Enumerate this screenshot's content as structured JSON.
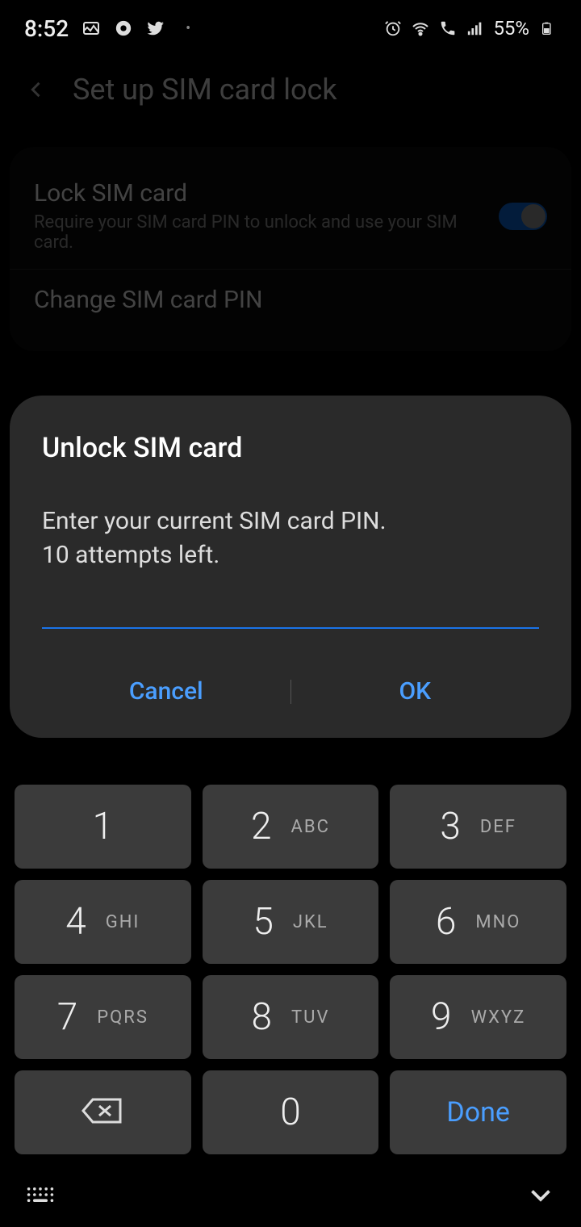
{
  "status": {
    "time": "8:52",
    "battery_percent": "55%"
  },
  "header": {
    "title": "Set up SIM card lock"
  },
  "settings": {
    "lock_sim": {
      "title": "Lock SIM card",
      "subtitle": "Require your SIM card PIN to unlock and use your SIM card.",
      "enabled": true
    },
    "change_pin": {
      "title": "Change SIM card PIN"
    }
  },
  "dialog": {
    "title": "Unlock SIM card",
    "message_line1": "Enter your current SIM card PIN.",
    "message_line2": "10 attempts left.",
    "cancel_label": "Cancel",
    "ok_label": "OK",
    "pin_value": ""
  },
  "keypad": {
    "keys": [
      {
        "digit": "1",
        "letters": ""
      },
      {
        "digit": "2",
        "letters": "ABC"
      },
      {
        "digit": "3",
        "letters": "DEF"
      },
      {
        "digit": "4",
        "letters": "GHI"
      },
      {
        "digit": "5",
        "letters": "JKL"
      },
      {
        "digit": "6",
        "letters": "MNO"
      },
      {
        "digit": "7",
        "letters": "PQRS"
      },
      {
        "digit": "8",
        "letters": "TUV"
      },
      {
        "digit": "9",
        "letters": "WXYZ"
      }
    ],
    "zero": "0",
    "done_label": "Done"
  }
}
